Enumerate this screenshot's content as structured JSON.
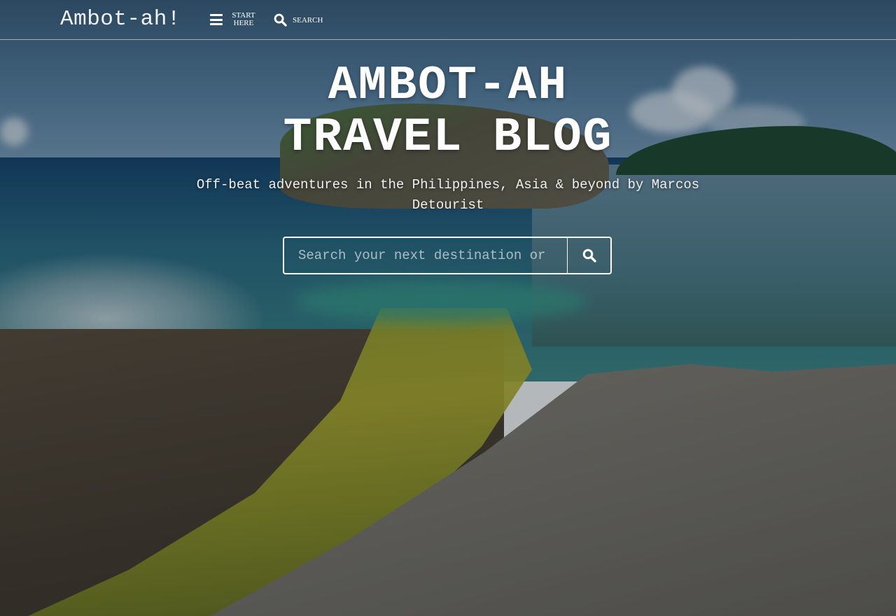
{
  "header": {
    "logo_text": "Ambot-ah!",
    "start_label": "START\nHERE",
    "search_label": "SEARCH"
  },
  "hero": {
    "title_line1": "AMBOT-AH",
    "title_line2": "TRAVEL BLOG",
    "tagline": "Off-beat adventures in the Philippines, Asia & beyond by Marcos Detourist"
  },
  "search": {
    "placeholder": "Search your next destination or topic",
    "button_icon": "search-icon"
  },
  "icons": {
    "menu": "menu-icon",
    "search": "search-icon"
  },
  "colors": {
    "text": "#ffffff",
    "divider": "rgba(255,255,255,0.55)"
  }
}
